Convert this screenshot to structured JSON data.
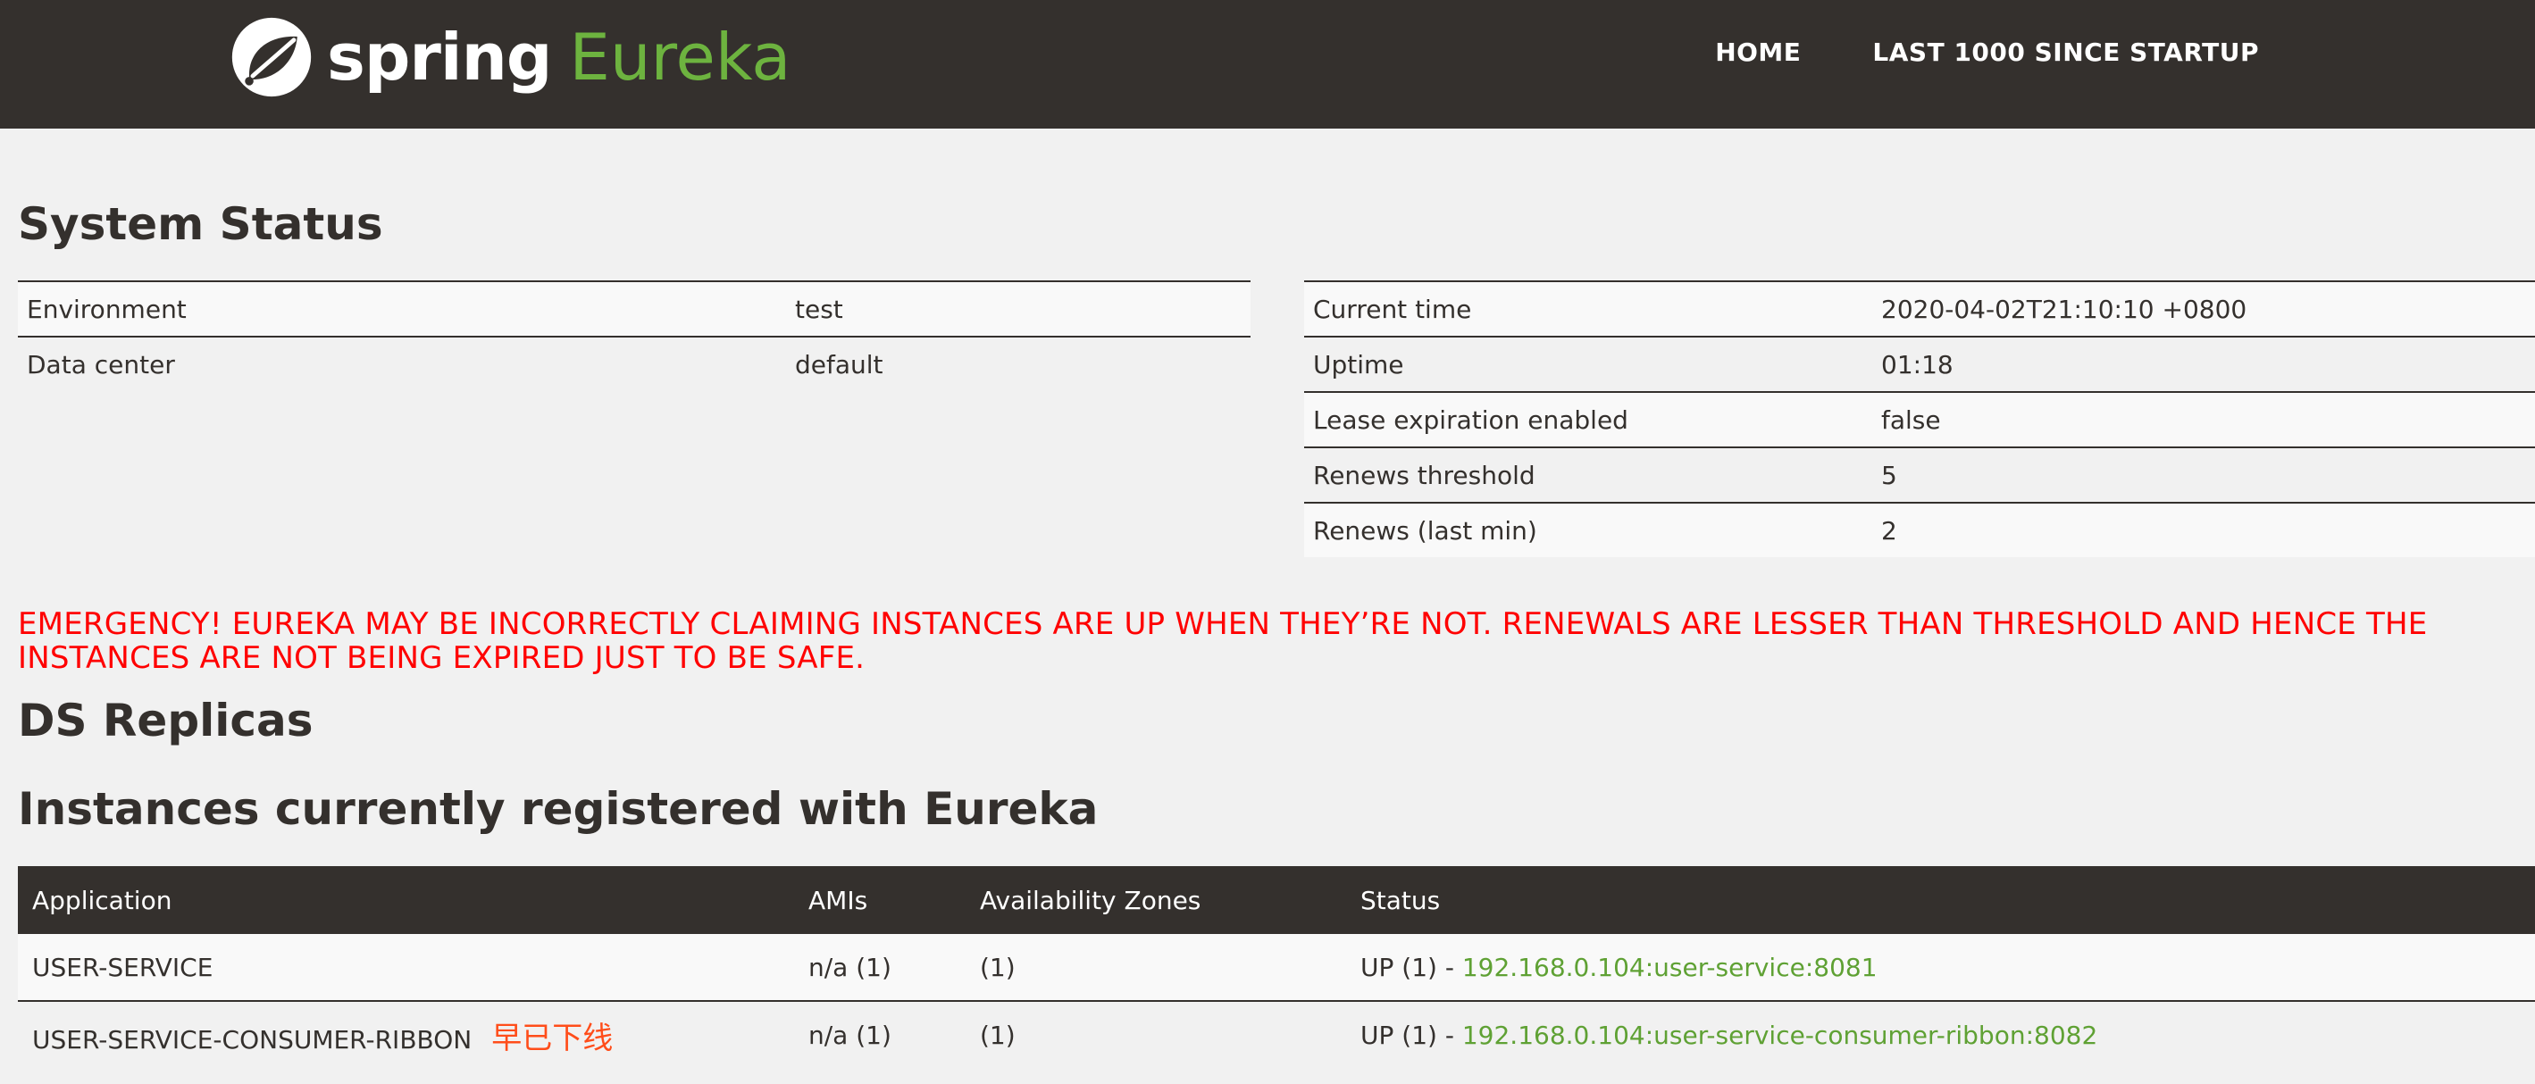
{
  "brand": {
    "spring": "spring",
    "eureka": "Eureka"
  },
  "nav": {
    "home": "HOME",
    "last1000": "LAST 1000 SINCE STARTUP"
  },
  "system_status": {
    "title": "System Status",
    "left": [
      {
        "label": "Environment",
        "value": "test"
      },
      {
        "label": "Data center",
        "value": "default"
      }
    ],
    "right": [
      {
        "label": "Current time",
        "value": "2020-04-02T21:10:10 +0800"
      },
      {
        "label": "Uptime",
        "value": "01:18"
      },
      {
        "label": "Lease expiration enabled",
        "value": "false"
      },
      {
        "label": "Renews threshold",
        "value": "5"
      },
      {
        "label": "Renews (last min)",
        "value": "2"
      }
    ]
  },
  "emergency": "EMERGENCY! EUREKA MAY BE INCORRECTLY CLAIMING INSTANCES ARE UP WHEN THEY’RE NOT. RENEWALS ARE LESSER THAN THRESHOLD AND HENCE THE INSTANCES ARE NOT BEING EXPIRED JUST TO BE SAFE.",
  "replicas_title": "DS Replicas",
  "instances": {
    "title": "Instances currently registered with Eureka",
    "columns": [
      "Application",
      "AMIs",
      "Availability Zones",
      "Status"
    ],
    "rows": [
      {
        "application": "USER-SERVICE",
        "note": "",
        "amis": "n/a (1)",
        "zones": "(1)",
        "status_prefix": "UP (1) - ",
        "link": "192.168.0.104:user-service:8081"
      },
      {
        "application": "USER-SERVICE-CONSUMER-RIBBON",
        "note": "早已下线",
        "amis": "n/a (1)",
        "zones": "(1)",
        "status_prefix": "UP (1) - ",
        "link": "192.168.0.104:user-service-consumer-ribbon:8082"
      }
    ]
  },
  "colors": {
    "header_bg": "#34302d",
    "brand_green": "#6db33f",
    "emergency_red": "#ff0000",
    "note_orange": "#ff4d1a",
    "link_green": "#5fa134"
  },
  "icons": {
    "logo": "spring-leaf-icon"
  }
}
